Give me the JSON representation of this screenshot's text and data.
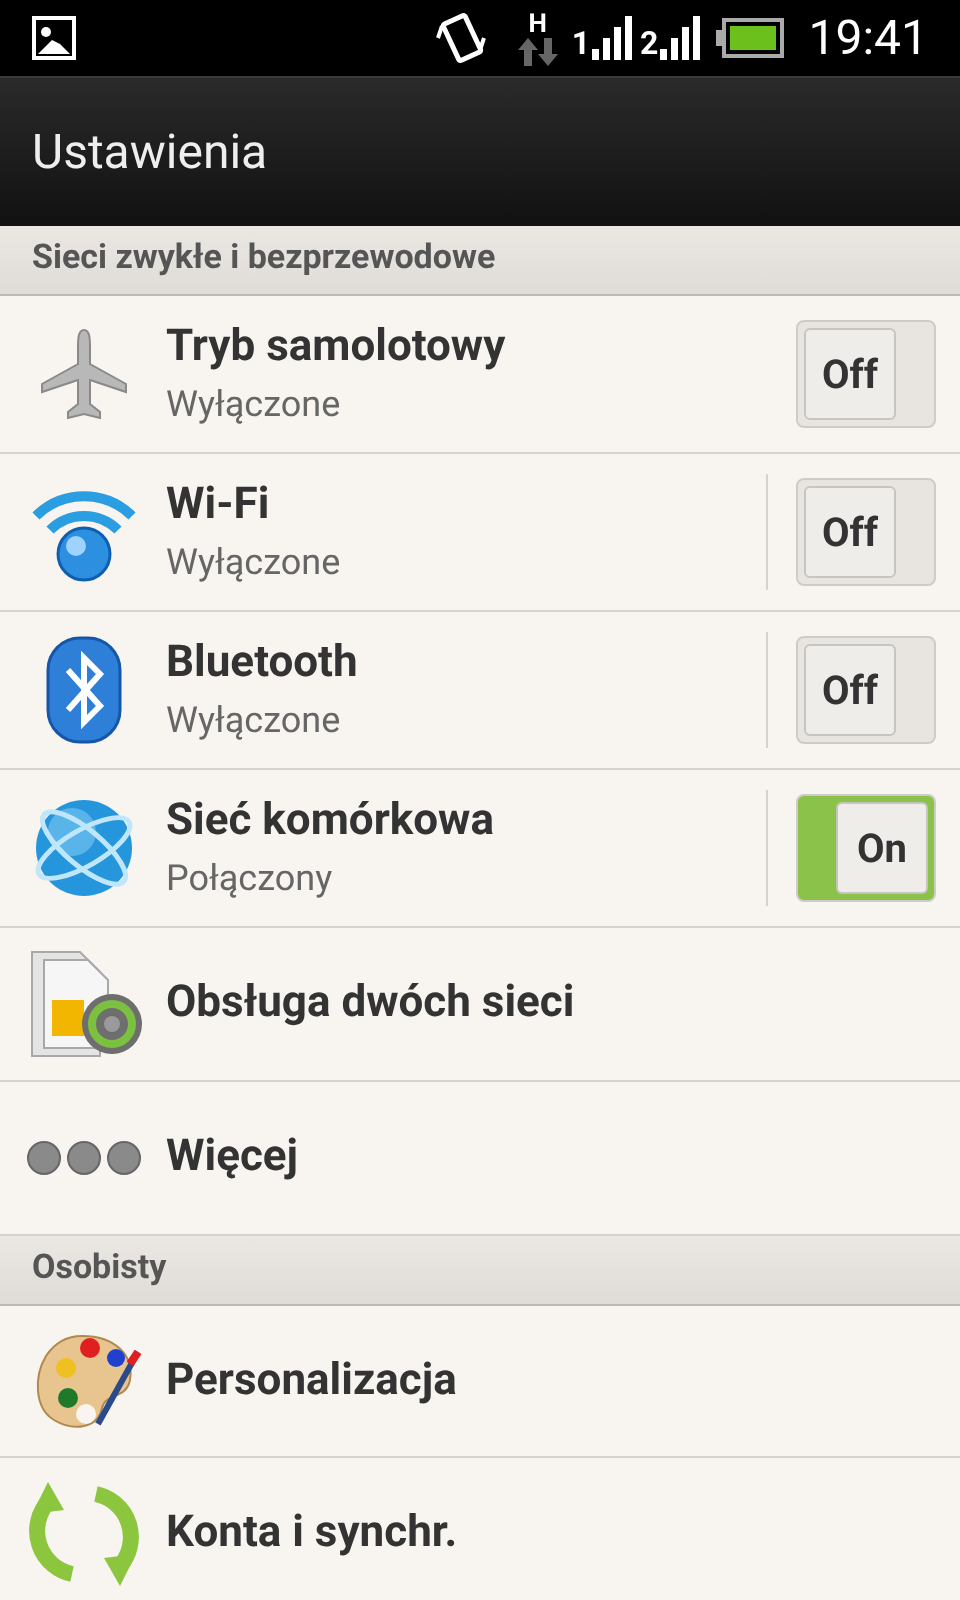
{
  "status_bar": {
    "network": "H",
    "sim_labels": [
      "1",
      "2"
    ],
    "time": "19:41"
  },
  "title": "Ustawienia",
  "sections": [
    {
      "header": "Sieci zwykłe i bezprzewodowe",
      "items": [
        {
          "kind": "toggle",
          "title": "Tryb samolotowy",
          "subtitle": "Wyłączone",
          "toggle_label": "Off",
          "on": false,
          "separator": false
        },
        {
          "kind": "toggle",
          "title": "Wi-Fi",
          "subtitle": "Wyłączone",
          "toggle_label": "Off",
          "on": false,
          "separator": true
        },
        {
          "kind": "toggle",
          "title": "Bluetooth",
          "subtitle": "Wyłączone",
          "toggle_label": "Off",
          "on": false,
          "separator": true
        },
        {
          "kind": "toggle",
          "title": "Sieć komórkowa",
          "subtitle": "Połączony",
          "toggle_label": "On",
          "on": true,
          "separator": true
        },
        {
          "kind": "link",
          "title": "Obsługa dwóch sieci"
        },
        {
          "kind": "link",
          "title": "Więcej"
        }
      ]
    },
    {
      "header": "Osobisty",
      "items": [
        {
          "kind": "link",
          "title": "Personalizacja"
        },
        {
          "kind": "link",
          "title": "Konta i synchr."
        }
      ]
    }
  ]
}
